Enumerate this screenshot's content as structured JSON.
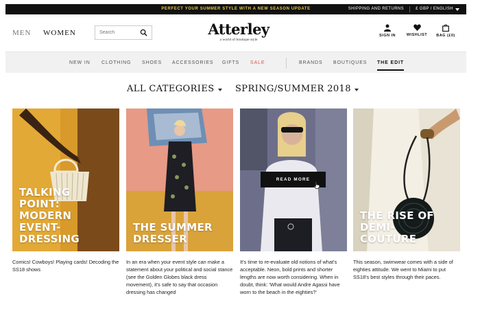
{
  "topbar": {
    "promo": "PERFECT YOUR SUMMER STYLE WITH A NEW SEASON UPDATE",
    "shipping": "SHIPPING AND RETURNS",
    "locale": "£ GBP / ENGLISH",
    "locale_icon": "chevron-down-icon"
  },
  "header": {
    "men": "MEN",
    "women": "WOMEN",
    "search_placeholder": "Search",
    "search_icon": "search-icon",
    "logo": "Atterley",
    "tagline": "a world of boutique style",
    "sign_in": "SIGN IN",
    "wishlist": "WISHLIST",
    "bag": "BAG (£0)",
    "icons": [
      "user-icon",
      "heart-icon",
      "bag-icon"
    ]
  },
  "nav": {
    "items": [
      "NEW IN",
      "CLOTHING",
      "SHOES",
      "ACCESSORIES",
      "GIFTS",
      "SALE",
      "BRANDS",
      "BOUTIQUES",
      "THE EDIT"
    ],
    "active": "THE EDIT",
    "sale_color": "#d9534f"
  },
  "filters": {
    "category": "ALL CATEGORIES",
    "season": "SPRING/SUMMER 2018"
  },
  "cards": [
    {
      "title": "TALKING\nPOINT:\nMODERN\nEVENT-\nDRESSING",
      "desc": "Comics! Cowboys! Playing cards! Decoding the SS18 shows"
    },
    {
      "title": "THE SUMMER\nDRESSER",
      "desc": "In an era when your event style can make a statement about your political and social stance (see the Golden Globes black dress movement), it's safe to say that occasion dressing has changed"
    },
    {
      "title": "",
      "desc": "It's time to re-evaluate old notions of what's acceptable. Neon, bold prints and shorter lengths are now worth considering. When in doubt, think: 'What would Andre Agassi have worn to the beach in the eighties?'",
      "button": "READ MORE"
    },
    {
      "title": "THE RISE OF\nDEMI-\nCOUTURE",
      "desc": "This season, swimwear comes with a side of eighties attitude. We went to Miami to put SS18's best styles through their paces."
    }
  ]
}
